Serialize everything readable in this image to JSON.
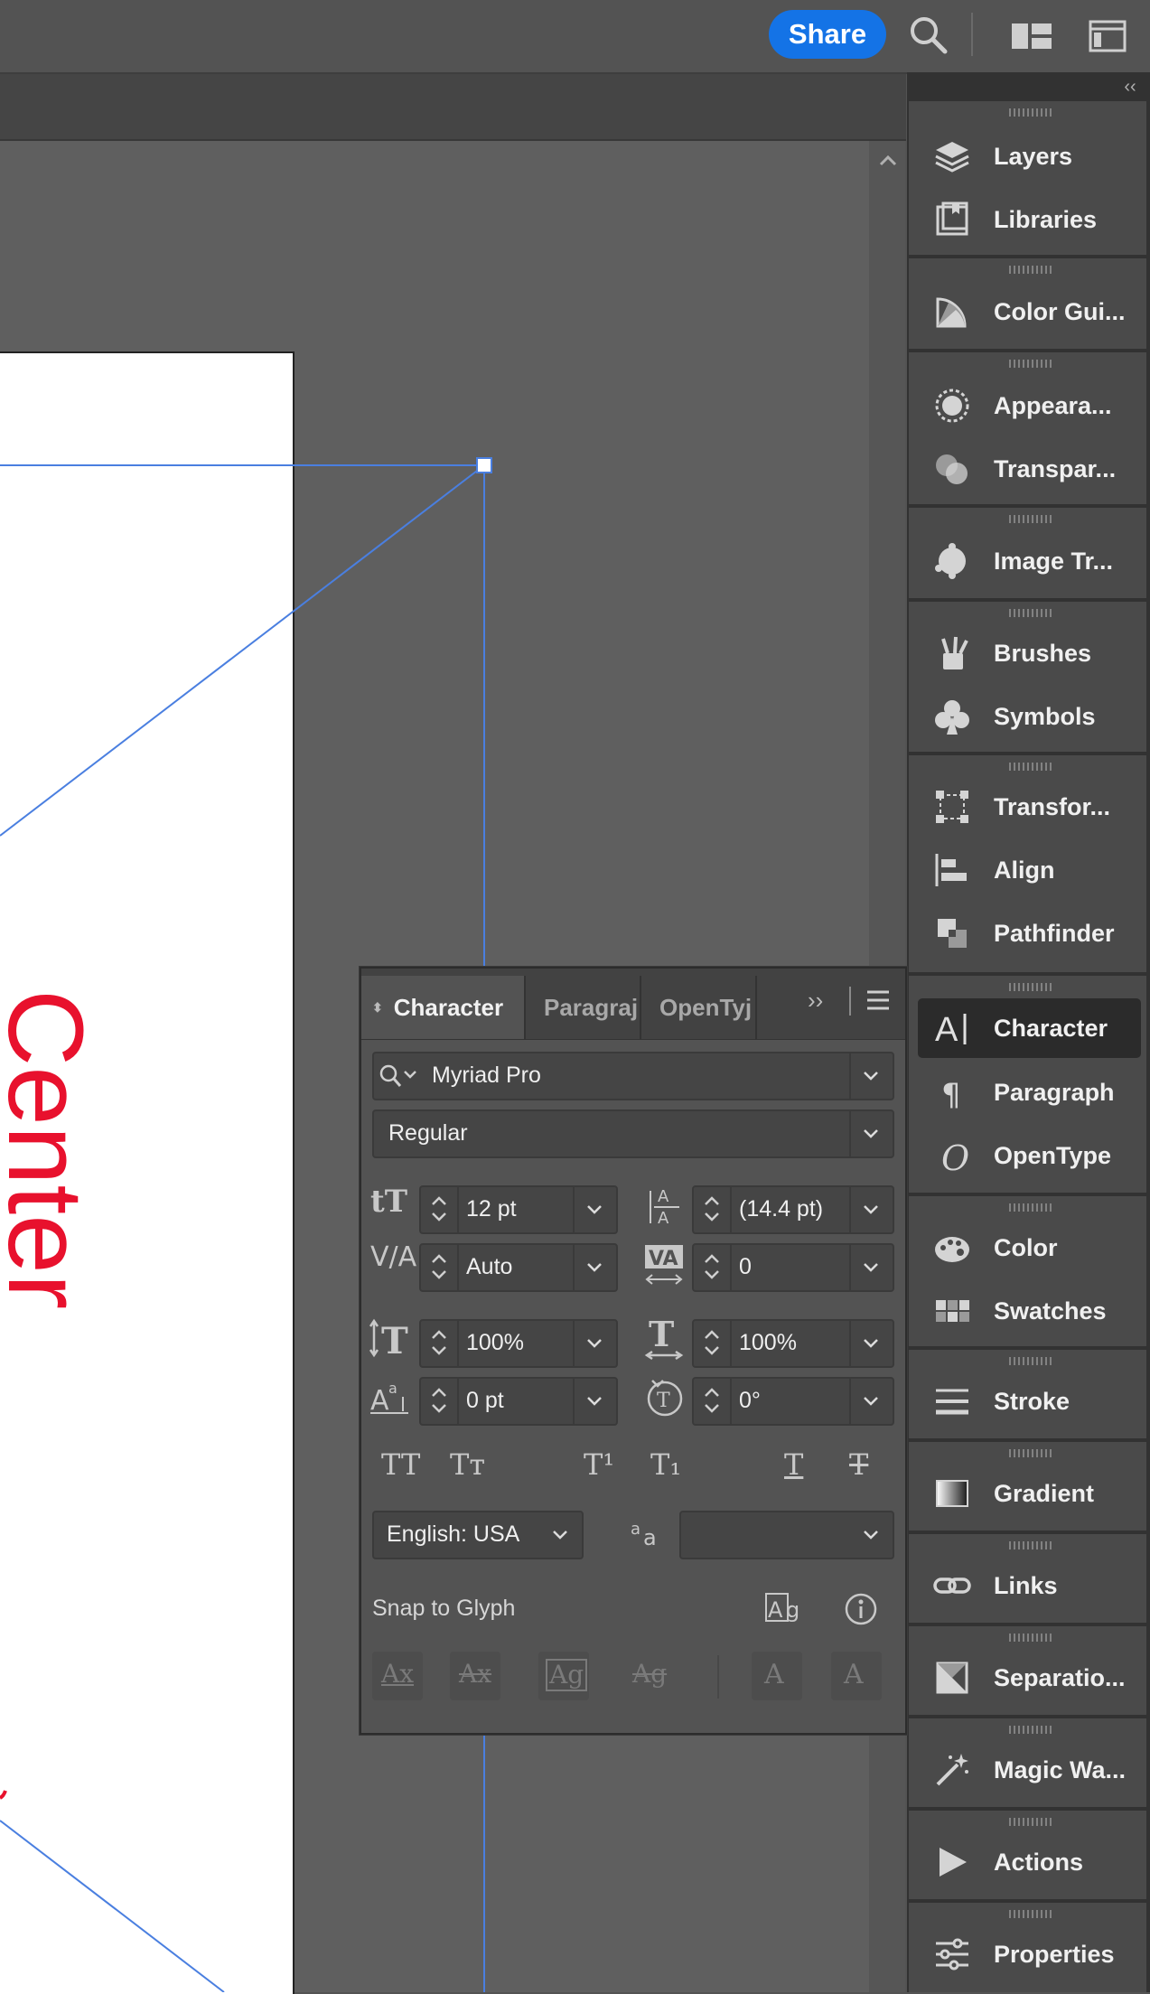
{
  "topbar": {
    "share_label": "Share"
  },
  "canvas": {
    "artwork_text": "Center"
  },
  "dock": {
    "groups": [
      {
        "items": [
          {
            "label": "Layers",
            "icon": "layers-icon"
          },
          {
            "label": "Libraries",
            "icon": "libraries-icon"
          }
        ]
      },
      {
        "items": [
          {
            "label": "Color Gui...",
            "icon": "color-guide-icon"
          }
        ]
      },
      {
        "items": [
          {
            "label": "Appeara...",
            "icon": "appearance-icon"
          },
          {
            "label": "Transpar...",
            "icon": "transparency-icon"
          }
        ]
      },
      {
        "items": [
          {
            "label": "Image Tr...",
            "icon": "image-trace-icon"
          }
        ]
      },
      {
        "items": [
          {
            "label": "Brushes",
            "icon": "brushes-icon"
          },
          {
            "label": "Symbols",
            "icon": "symbols-icon"
          }
        ]
      },
      {
        "items": [
          {
            "label": "Transfor...",
            "icon": "transform-icon"
          },
          {
            "label": "Align",
            "icon": "align-icon"
          },
          {
            "label": "Pathfinder",
            "icon": "pathfinder-icon"
          }
        ]
      },
      {
        "items": [
          {
            "label": "Character",
            "icon": "character-icon",
            "active": true
          },
          {
            "label": "Paragraph",
            "icon": "paragraph-icon"
          },
          {
            "label": "OpenType",
            "icon": "opentype-icon"
          }
        ]
      },
      {
        "items": [
          {
            "label": "Color",
            "icon": "color-palette-icon"
          },
          {
            "label": "Swatches",
            "icon": "swatches-icon"
          }
        ]
      },
      {
        "items": [
          {
            "label": "Stroke",
            "icon": "stroke-icon"
          }
        ]
      },
      {
        "items": [
          {
            "label": "Gradient",
            "icon": "gradient-icon"
          }
        ]
      },
      {
        "items": [
          {
            "label": "Links",
            "icon": "links-icon"
          }
        ]
      },
      {
        "items": [
          {
            "label": "Separatio...",
            "icon": "separations-icon"
          }
        ]
      },
      {
        "items": [
          {
            "label": "Magic Wa...",
            "icon": "magic-wand-icon"
          }
        ]
      },
      {
        "items": [
          {
            "label": "Actions",
            "icon": "actions-play-icon"
          }
        ]
      },
      {
        "items": [
          {
            "label": "Properties",
            "icon": "properties-icon"
          }
        ]
      }
    ]
  },
  "character_panel": {
    "tabs": [
      "Character",
      "Paragraj",
      "OpenTyj"
    ],
    "font_family": "Myriad Pro",
    "font_style": "Regular",
    "font_size": "12 pt",
    "leading": "(14.4 pt)",
    "kerning": "Auto",
    "tracking": "0",
    "vertical_scale": "100%",
    "horizontal_scale": "100%",
    "baseline_shift": "0 pt",
    "rotation": "0°",
    "language": "English: USA",
    "anti_aliasing": "",
    "snap_label": "Snap to Glyph",
    "style_buttons": {
      "all_caps": "TT",
      "small_caps": "Tт",
      "superscript": "T¹",
      "subscript": "T₁",
      "underline": "T",
      "strikethrough": "T"
    },
    "snap_buttons": {
      "baseline": "Ax",
      "xheight": "Ax",
      "glyph_bounds": "Ag",
      "proximity": "Ag",
      "angular": "A",
      "anchor": "A"
    }
  },
  "colors": {
    "accent": "#1473e6",
    "artwork_text": "#e8112d",
    "guide_line": "#4a7fe0"
  }
}
